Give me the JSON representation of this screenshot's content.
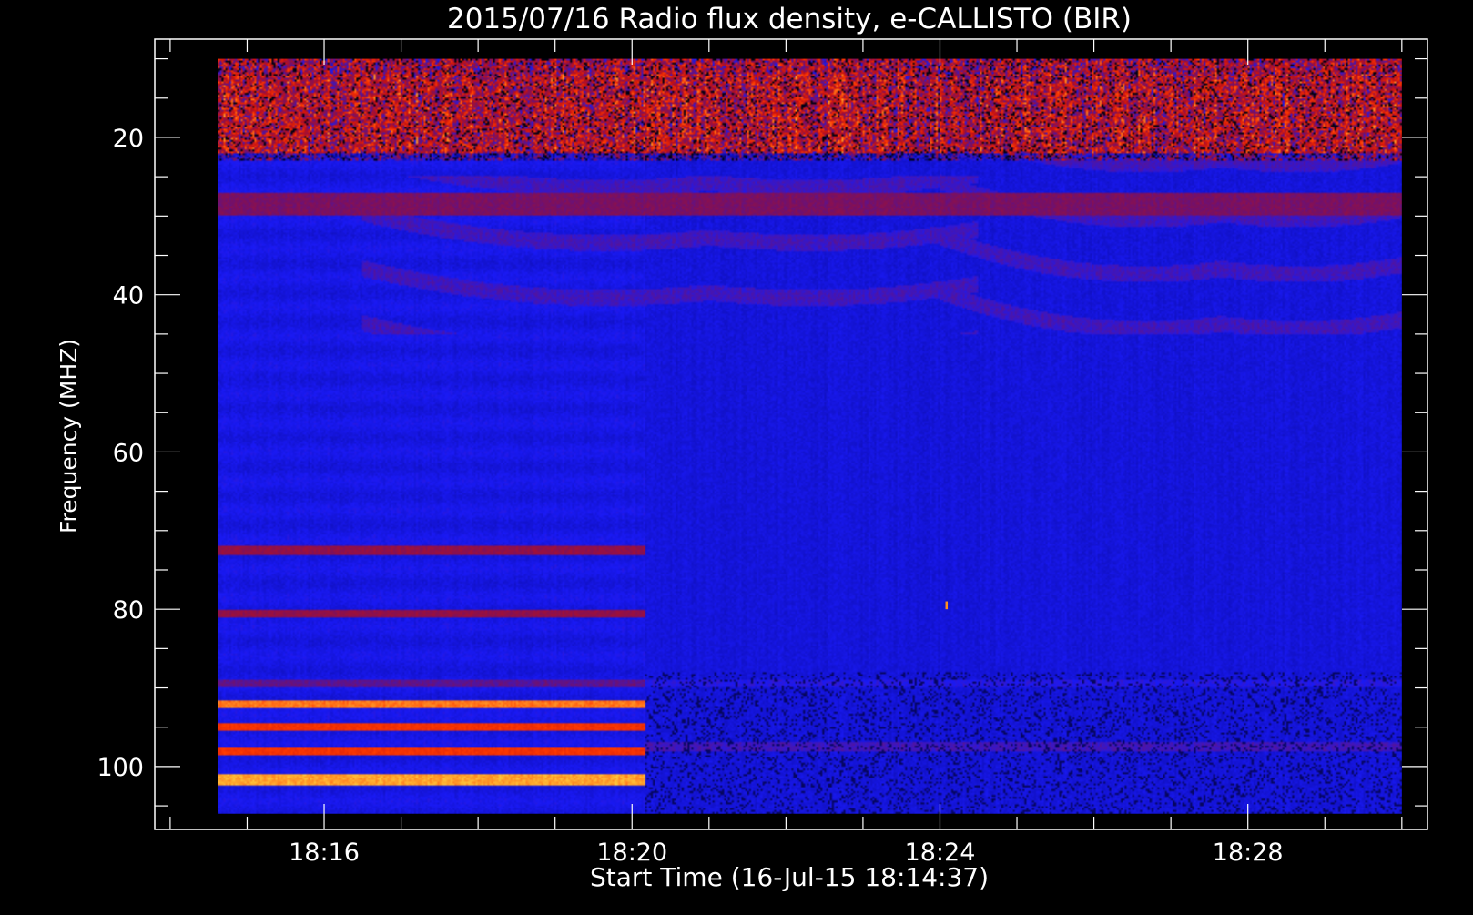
{
  "chart_data": {
    "type": "heatmap",
    "title": "2015/07/16  Radio flux density, e-CALLISTO (BIR)",
    "xlabel": "Start Time (16-Jul-15 18:14:37)",
    "ylabel": "Frequency (MHZ)",
    "x_axis": {
      "unit": "time",
      "range": [
        "18:14:37",
        "18:30:00"
      ],
      "major_ticks": [
        {
          "value": "18:16",
          "label": "18:16"
        },
        {
          "value": "18:20",
          "label": "18:20"
        },
        {
          "value": "18:24",
          "label": "18:24"
        },
        {
          "value": "18:28",
          "label": "18:28"
        }
      ]
    },
    "y_axis": {
      "unit": "MHz",
      "inverted": true,
      "range": [
        10,
        106
      ],
      "major_ticks": [
        {
          "value": 20,
          "label": "20"
        },
        {
          "value": 40,
          "label": "40"
        },
        {
          "value": 60,
          "label": "60"
        },
        {
          "value": 80,
          "label": "80"
        },
        {
          "value": 100,
          "label": "100"
        }
      ]
    },
    "plot_range": {
      "x": [
        "18:13:48",
        "18:30:20"
      ],
      "y": [
        7.5,
        108
      ]
    },
    "colormap": [
      "#000000",
      "#0a0aa0",
      "#1a1af5",
      "#7a1060",
      "#c81010",
      "#ff3a00",
      "#ffd040"
    ],
    "grid": false,
    "regime_change_time": "18:20:10",
    "bands": [
      {
        "freq_range": [
          10,
          12
        ],
        "intensity": 0.55,
        "time_range": [
          "18:14:37",
          "18:30:00"
        ]
      },
      {
        "freq_range": [
          12,
          22
        ],
        "intensity": 0.6,
        "time_range": [
          "18:14:37",
          "18:30:00"
        ]
      },
      {
        "freq_range": [
          27,
          30
        ],
        "intensity": 0.5,
        "time_range": [
          "18:14:37",
          "18:30:00"
        ]
      },
      {
        "freq_range": [
          72,
          73
        ],
        "intensity": 0.55,
        "time_range": [
          "18:14:37",
          "18:20:10"
        ]
      },
      {
        "freq_range": [
          80,
          81
        ],
        "intensity": 0.55,
        "time_range": [
          "18:14:37",
          "18:20:10"
        ]
      },
      {
        "freq_range": [
          89,
          90
        ],
        "intensity": 0.45,
        "time_range": [
          "18:14:37",
          "18:20:10"
        ]
      },
      {
        "freq_range": [
          91.5,
          92.5
        ],
        "intensity": 0.9,
        "time_range": [
          "18:14:37",
          "18:20:10"
        ]
      },
      {
        "freq_range": [
          94.5,
          95.5
        ],
        "intensity": 0.8,
        "time_range": [
          "18:14:37",
          "18:20:10"
        ]
      },
      {
        "freq_range": [
          97.5,
          98.5
        ],
        "intensity": 0.8,
        "time_range": [
          "18:14:37",
          "18:20:10"
        ]
      },
      {
        "freq_range": [
          101,
          102.5
        ],
        "intensity": 0.95,
        "time_range": [
          "18:14:37",
          "18:20:10"
        ]
      },
      {
        "freq_range": [
          89,
          90
        ],
        "intensity": 0.35,
        "time_range": [
          "18:20:10",
          "18:30:00"
        ]
      },
      {
        "freq_range": [
          97,
          98
        ],
        "intensity": 0.4,
        "time_range": [
          "18:20:10",
          "18:30:00"
        ]
      }
    ],
    "features": [
      {
        "name": "arc",
        "time_range": [
          "18:16:30",
          "18:24:30"
        ],
        "center_time": "18:21:00",
        "freq_range": [
          25,
          45
        ],
        "intensity": 0.35
      },
      {
        "name": "arc",
        "time_range": [
          "18:24:00",
          "18:30:00"
        ],
        "center_time": "18:27:40",
        "freq_range": [
          22,
          45
        ],
        "intensity": 0.35
      },
      {
        "name": "spike",
        "time": "18:24:05",
        "freq_range": [
          79,
          80
        ],
        "intensity": 0.7
      }
    ]
  }
}
